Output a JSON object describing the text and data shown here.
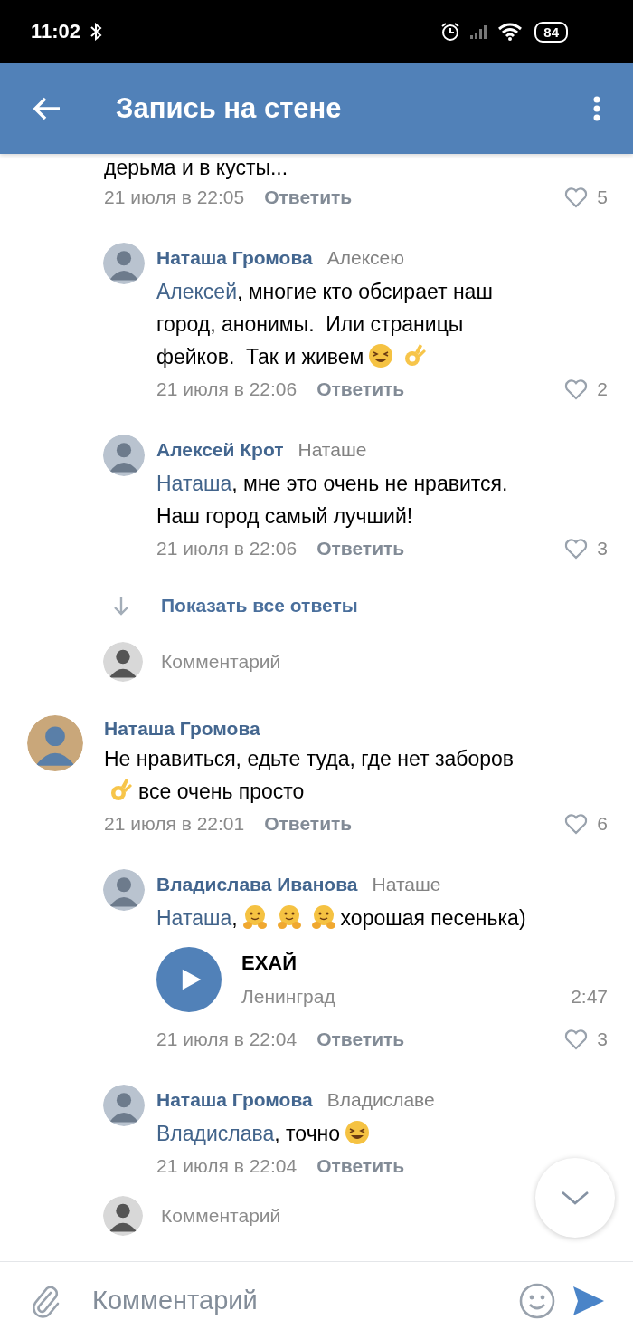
{
  "status_bar": {
    "time": "11:02",
    "battery": "84"
  },
  "header": {
    "title": "Запись на стене"
  },
  "threads": [
    {
      "body": [
        {
          "kind": "text",
          "text": "дерьма и в кусты..."
        }
      ],
      "date": "21 июля в 22:05",
      "reply": "Ответить",
      "likes": "5",
      "replies": [
        {
          "author": "Наташа Громова",
          "to": "Алексею",
          "body": [
            {
              "kind": "mention",
              "text": "Алексей"
            },
            {
              "kind": "text",
              "text": ", многие кто обсирает наш город, анонимы.  Или страницы фейков.  Так и живем"
            },
            {
              "kind": "laugh"
            },
            {
              "kind": "ok"
            }
          ],
          "date": "21 июля в 22:06",
          "reply": "Ответить",
          "likes": "2"
        },
        {
          "author": "Алексей Крот",
          "to": "Наташе",
          "body": [
            {
              "kind": "mention",
              "text": "Наташа"
            },
            {
              "kind": "text",
              "text": ", мне это очень не нравится. Наш город самый лучший!"
            }
          ],
          "date": "21 июля в 22:06",
          "reply": "Ответить",
          "likes": "3"
        }
      ],
      "show_all": "Показать все ответы",
      "reply_field": {
        "placeholder": "Комментарий"
      }
    },
    {
      "author": "Наташа Громова",
      "body": [
        {
          "kind": "text",
          "text": "Не нравиться, едьте туда, где нет заборов"
        },
        {
          "kind": "ok"
        },
        {
          "kind": "text",
          "text": "все очень просто"
        }
      ],
      "date": "21 июля в 22:01",
      "reply": "Ответить",
      "likes": "6",
      "replies": [
        {
          "author": "Владислава Иванова",
          "to": "Наташе",
          "body": [
            {
              "kind": "mention",
              "text": "Наташа"
            },
            {
              "kind": "text",
              "text": ","
            },
            {
              "kind": "hug"
            },
            {
              "kind": "hug"
            },
            {
              "kind": "hug"
            },
            {
              "kind": "text",
              "text": "хорошая песенька)"
            }
          ],
          "audio": {
            "title": "ЕХАЙ",
            "artist": "Ленинград",
            "duration": "2:47"
          },
          "date": "21 июля в 22:04",
          "reply": "Ответить",
          "likes": "3"
        },
        {
          "author": "Наташа Громова",
          "to": "Владиславе",
          "body": [
            {
              "kind": "mention",
              "text": "Владислава"
            },
            {
              "kind": "text",
              "text": ", точно"
            },
            {
              "kind": "laugh"
            }
          ],
          "date": "21 июля в 22:04",
          "reply": "Ответить"
        }
      ],
      "reply_field": {
        "placeholder": "Комментарий"
      }
    }
  ],
  "composer": {
    "placeholder": "Комментарий"
  }
}
